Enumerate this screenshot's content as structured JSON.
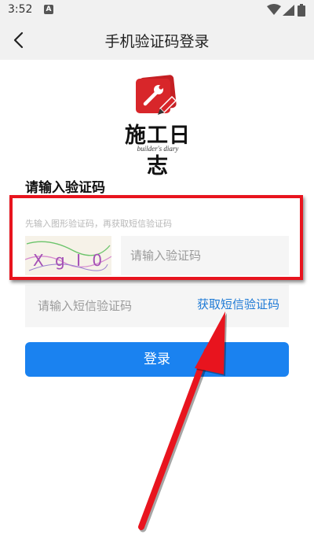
{
  "status_bar": {
    "time": "3:52",
    "notification_badge": "A",
    "icons": [
      "wifi-icon",
      "signal-icon",
      "battery-icon"
    ]
  },
  "nav": {
    "title": "手机验证码登录",
    "back_icon": "chevron-left-icon"
  },
  "logo": {
    "title": "施工日志",
    "subtitle": "builder's diary",
    "brand_color": "#d8262a"
  },
  "form": {
    "section_title": "请输入验证码",
    "captcha_hint": "先输入图形验证码，再获取短信验证码",
    "captcha_image_text": "X g I 0",
    "captcha_input_placeholder": "请输入验证码",
    "sms_input_placeholder": "请输入短信验证码",
    "get_sms_label": "获取短信验证码",
    "login_label": "登录"
  },
  "colors": {
    "accent": "#1a82f0",
    "link": "#1e7ad6",
    "annotation": "#e8141e"
  },
  "annotation": {
    "highlight": "red-box-around-captcha-fields",
    "arrow": "red-arrow-pointing-to-get-sms-button"
  }
}
